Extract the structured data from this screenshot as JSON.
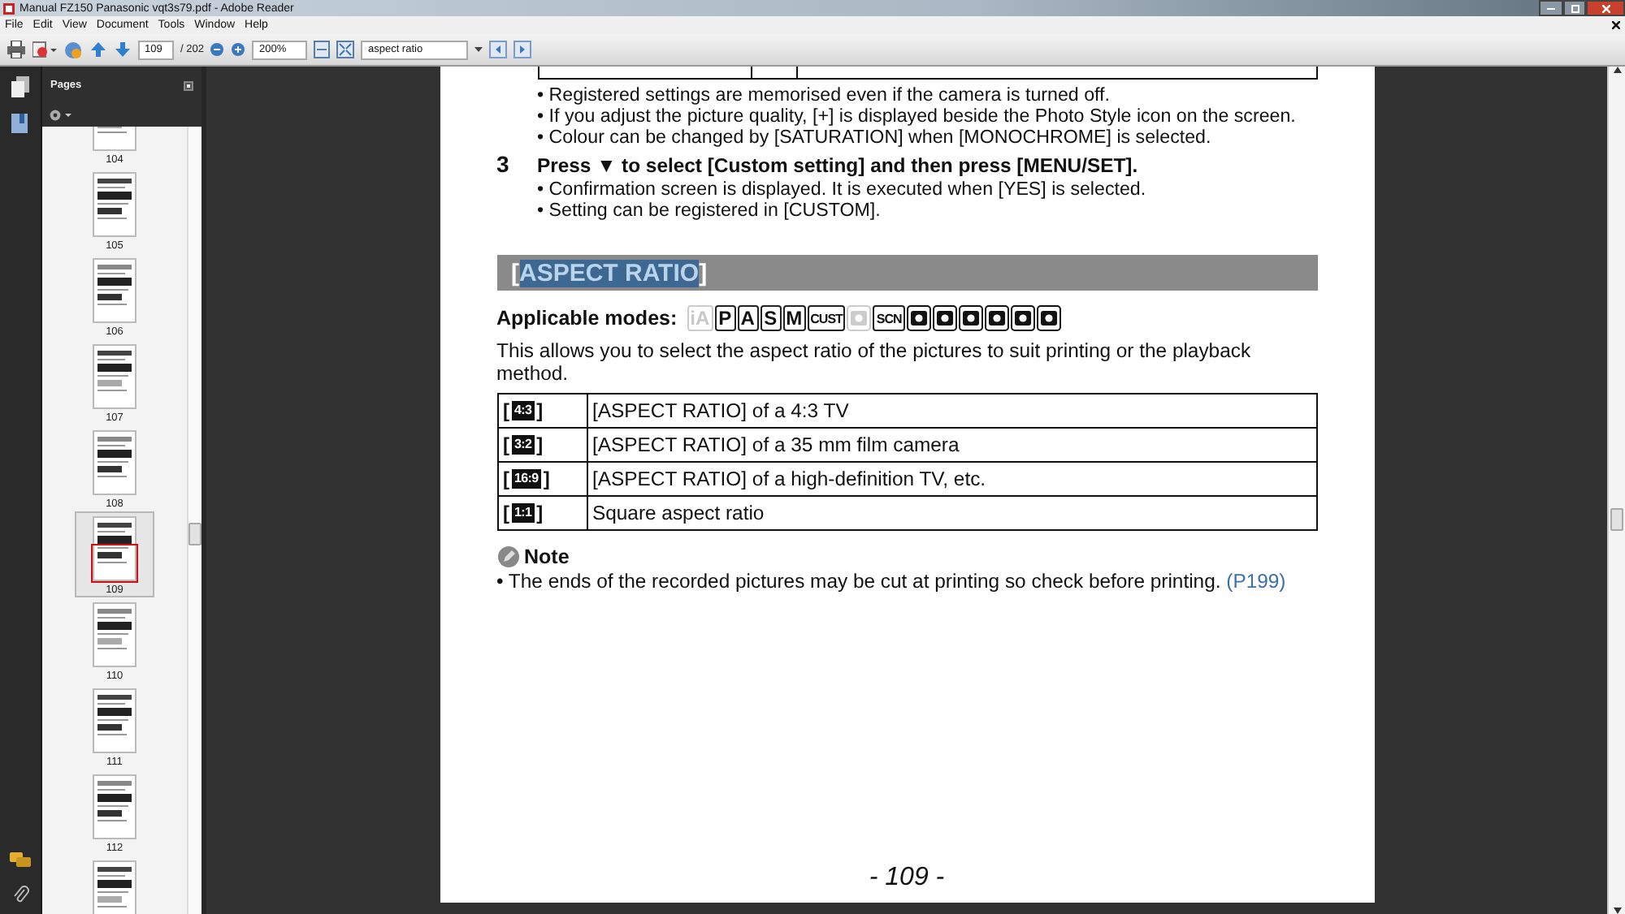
{
  "window": {
    "title": "Manual FZ150 Panasonic vqt3s79.pdf - Adobe Reader"
  },
  "menu": [
    "File",
    "Edit",
    "View",
    "Document",
    "Tools",
    "Window",
    "Help"
  ],
  "toolbar": {
    "page_number": "109",
    "page_total": "/ 202",
    "zoom": "200%",
    "search": "aspect ratio"
  },
  "sidebar": {
    "title": "Pages",
    "thumbnails": [
      {
        "label": "104",
        "selected": false
      },
      {
        "label": "105",
        "selected": false
      },
      {
        "label": "106",
        "selected": false
      },
      {
        "label": "107",
        "selected": false
      },
      {
        "label": "108",
        "selected": false
      },
      {
        "label": "109",
        "selected": true
      },
      {
        "label": "110",
        "selected": false
      },
      {
        "label": "111",
        "selected": false
      },
      {
        "label": "112",
        "selected": false
      },
      {
        "selected": false
      }
    ]
  },
  "document": {
    "bullets_top": [
      "• Registered settings are memorised even if the camera is turned off.",
      "• If you adjust the picture quality, [+] is displayed beside the Photo Style icon on the screen.",
      "• Colour can be changed by [SATURATION] when [MONOCHROME] is selected."
    ],
    "step": {
      "number": "3",
      "text": "Press ▼ to select [Custom setting] and then press [MENU/SET].",
      "bullets": [
        "• Confirmation screen is displayed. It is executed when [YES] is selected.",
        "• Setting can be registered in [CUSTOM]."
      ]
    },
    "heading": {
      "before": "[",
      "highlight": "ASPECT RATIO",
      "after": "]"
    },
    "modes_label": "Applicable modes:",
    "modes": [
      {
        "kind": "letter",
        "label": "iA",
        "enabled": false
      },
      {
        "kind": "letter",
        "label": "P",
        "enabled": true
      },
      {
        "kind": "letter",
        "label": "A",
        "enabled": true
      },
      {
        "kind": "letter",
        "label": "S",
        "enabled": true
      },
      {
        "kind": "letter",
        "label": "M",
        "enabled": true
      },
      {
        "kind": "letter",
        "label": "CUST",
        "enabled": true
      },
      {
        "kind": "symbol",
        "enabled": false
      },
      {
        "kind": "letter",
        "label": "SCN",
        "enabled": true
      },
      {
        "kind": "symbol",
        "enabled": true
      },
      {
        "kind": "symbol",
        "enabled": true
      },
      {
        "kind": "symbol",
        "enabled": true
      },
      {
        "kind": "symbol",
        "enabled": true
      },
      {
        "kind": "symbol",
        "enabled": true
      },
      {
        "kind": "symbol",
        "enabled": true
      }
    ],
    "intro": "This allows you to select the aspect ratio of the pictures to suit printing or the playback method.",
    "rows": [
      {
        "open": "[",
        "badge": "4:3",
        "close": "]",
        "description": "[ASPECT RATIO] of a 4:3 TV"
      },
      {
        "open": "[",
        "badge": "3:2",
        "close": "]",
        "description": "[ASPECT RATIO] of a 35 mm film camera"
      },
      {
        "open": "[",
        "badge": "16:9",
        "close": "]",
        "description": "[ASPECT RATIO] of a high-definition TV, etc."
      },
      {
        "open": "[",
        "badge": "1:1",
        "close": "]",
        "description": "Square aspect ratio"
      }
    ],
    "note_title": "Note",
    "note": {
      "text": "• The ends of the recorded pictures may be cut at printing so check before printing.",
      "link": "(P199)"
    },
    "page_footer": "- 109 -"
  }
}
